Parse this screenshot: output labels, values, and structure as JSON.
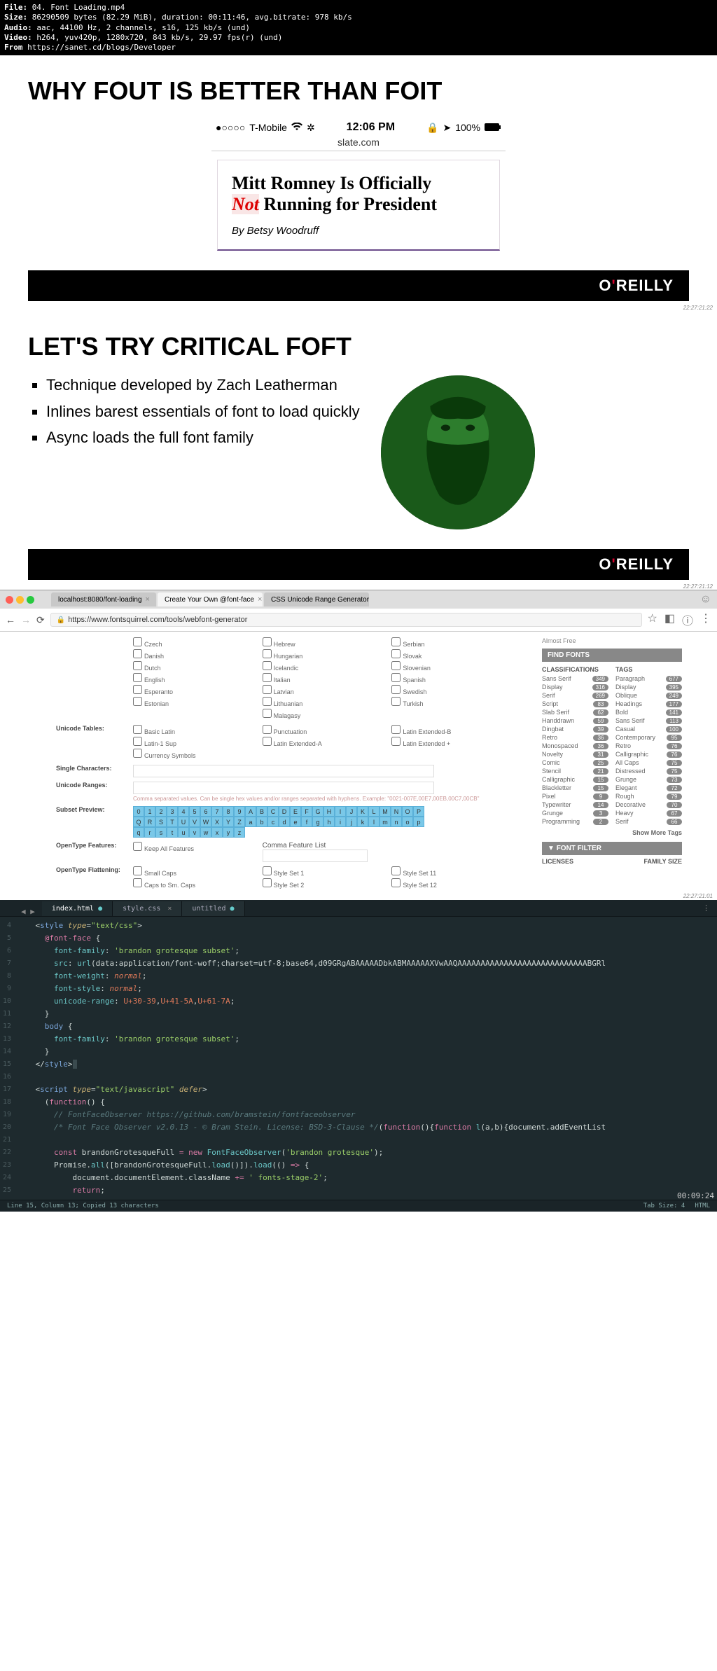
{
  "meta": {
    "file_label": "File:",
    "file": "04. Font Loading.mp4",
    "size_label": "Size:",
    "size": "86290509 bytes (82.29 MiB), duration: 00:11:46, avg.bitrate: 978 kb/s",
    "audio_label": "Audio:",
    "audio": "aac, 44100 Hz, 2 channels, s16, 125 kb/s (und)",
    "video_label": "Video:",
    "video": "h264, yuv420p, 1280x720, 843 kb/s, 29.97 fps(r) (und)",
    "from_label": "From",
    "from": "https://sanet.cd/blogs/Developer"
  },
  "slide1": {
    "title": "WHY FOUT IS BETTER THAN FOIT",
    "phone": {
      "carrier": "T-Mobile",
      "time": "12:06 PM",
      "battery": "100%",
      "url": "slate.com",
      "headline_pre": "Mitt Romney Is Officially",
      "headline_not": "Not",
      "headline_post": " Running for President",
      "byline": "By Betsy Woodruff"
    },
    "brand_pre": "O",
    "brand_apos": "'",
    "brand_post": "REILLY",
    "ts": "22:27:21:22"
  },
  "slide2": {
    "title": "LET'S TRY CRITICAL FOFT",
    "bullets": [
      "Technique developed by Zach Leatherman",
      "Inlines barest essentials of font to load quickly",
      "Async loads the full font family"
    ],
    "ts": "22:27:21:12"
  },
  "browser": {
    "tabs": [
      "localhost:8080/font-loading",
      "Create Your Own @font-face",
      "CSS Unicode Range Generator"
    ],
    "url": "https://www.fontsquirrel.com/tools/webfont-generator",
    "languages": {
      "col1": [
        "Czech",
        "Danish",
        "Dutch",
        "English",
        "Esperanto",
        "Estonian"
      ],
      "col2": [
        "Hebrew",
        "Hungarian",
        "Icelandic",
        "Italian",
        "Latvian",
        "Lithuanian",
        "Malagasy"
      ],
      "col3": [
        "Serbian",
        "Slovak",
        "Slovenian",
        "Spanish",
        "Swedish",
        "Turkish"
      ]
    },
    "labels": {
      "unicode_tables": "Unicode Tables:",
      "single_chars": "Single Characters:",
      "unicode_ranges": "Unicode Ranges:",
      "subset_preview": "Subset Preview:",
      "opentype_features": "OpenType Features:",
      "opentype_flattening": "OpenType Flattening:"
    },
    "tables": {
      "col1": [
        "Basic Latin",
        "Latin-1 Sup",
        "Currency Symbols"
      ],
      "col2": [
        "Punctuation",
        "Latin Extended-A"
      ],
      "col3": [
        "Latin Extended-B",
        "Latin Extended +"
      ]
    },
    "ranges_hint": "Comma separated values. Can be single hex values and/or ranges separated with hyphens. Example: \"0021-007E,00E7,00EB,00C7,00CB\"",
    "preview_chars": [
      "0",
      "1",
      "2",
      "3",
      "4",
      "5",
      "6",
      "7",
      "8",
      "9",
      "A",
      "B",
      "C",
      "D",
      "E",
      "F",
      "G",
      "H",
      "I",
      "J",
      "K",
      "L",
      "M",
      "N",
      "O",
      "P",
      "Q",
      "R",
      "S",
      "T",
      "U",
      "V",
      "W",
      "X",
      "Y",
      "Z",
      "a",
      "b",
      "c",
      "d",
      "e",
      "f",
      "g",
      "h",
      "i",
      "j",
      "k",
      "l",
      "m",
      "n",
      "o",
      "p",
      "q",
      "r",
      "s",
      "t",
      "u",
      "v",
      "w",
      "x",
      "y",
      "z"
    ],
    "ot_features": {
      "keep_all": "Keep All Features",
      "comma_list": "Comma Feature List"
    },
    "ot_flatten": {
      "col1": [
        "Small Caps",
        "Caps to Sm. Caps"
      ],
      "col2": [
        "Style Set 1",
        "Style Set 2"
      ],
      "col3": [
        "Style Set 11",
        "Style Set 12"
      ]
    },
    "sidebar": {
      "promo": "Almost Free",
      "find_fonts": "FIND FONTS",
      "classifications": "CLASSIFICATIONS",
      "tags_head": "TAGS",
      "classifications_list": [
        [
          "Sans Serif",
          "349"
        ],
        [
          "Display",
          "316"
        ],
        [
          "Serif",
          "269"
        ],
        [
          "Script",
          "83"
        ],
        [
          "Slab Serif",
          "62"
        ],
        [
          "Handdrawn",
          "59"
        ],
        [
          "Dingbat",
          "39"
        ],
        [
          "Retro",
          "36"
        ],
        [
          "Monospaced",
          "36"
        ],
        [
          "Novelty",
          "31"
        ],
        [
          "Comic",
          "25"
        ],
        [
          "Stencil",
          "21"
        ],
        [
          "Calligraphic",
          "15"
        ],
        [
          "Blackletter",
          "15"
        ],
        [
          "Pixel",
          "9"
        ],
        [
          "Typewriter",
          "14"
        ],
        [
          "Grunge",
          "3"
        ],
        [
          "Programming",
          "2"
        ]
      ],
      "tags_list": [
        [
          "Paragraph",
          "677"
        ],
        [
          "Display",
          "395"
        ],
        [
          "Oblique",
          "249"
        ],
        [
          "Headings",
          "177"
        ],
        [
          "Bold",
          "141"
        ],
        [
          "Sans Serif",
          "113"
        ],
        [
          "Casual",
          "100"
        ],
        [
          "Contemporary",
          "95"
        ],
        [
          "Retro",
          "76"
        ],
        [
          "Calligraphic",
          "76"
        ],
        [
          "All Caps",
          "75"
        ],
        [
          "Distressed",
          "75"
        ],
        [
          "Grunge",
          "73"
        ],
        [
          "Elegant",
          "72"
        ],
        [
          "Rough",
          "79"
        ],
        [
          "Decorative",
          "70"
        ],
        [
          "Heavy",
          "67"
        ],
        [
          "Serif",
          "66"
        ]
      ],
      "show_more": "Show More Tags",
      "font_filter": "FONT FILTER",
      "licenses": "LICENSES",
      "family_size": "FAMILY SIZE"
    },
    "ts": "22:27:21:01"
  },
  "editor": {
    "tabs": {
      "t1": "index.html",
      "t2": "style.css",
      "t3": "untitled"
    },
    "status": {
      "left": "Line 15, Column 13; Copied 13 characters",
      "tabsize": "Tab Size: 4",
      "lang": "HTML"
    },
    "ts": "00:09:24"
  }
}
